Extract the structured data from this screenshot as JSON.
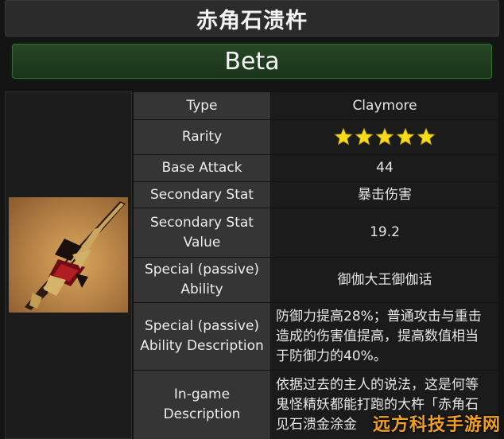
{
  "header": {
    "title": "赤角石溃杵"
  },
  "banner": {
    "label": "Beta"
  },
  "stats": {
    "type_label": "Type",
    "type_value": "Claymore",
    "rarity_label": "Rarity",
    "rarity_stars": 5,
    "base_attack_label": "Base Attack",
    "base_attack_value": "44",
    "secondary_stat_label": "Secondary Stat",
    "secondary_stat_value": "暴击伤害",
    "secondary_stat_value_label_1": "Secondary Stat",
    "secondary_stat_value_label_2": "Value",
    "secondary_stat_value_value": "19.2",
    "special_ability_label_1": "Special (passive)",
    "special_ability_label_2": "Ability",
    "special_ability_value": "御伽大王御伽话",
    "special_desc_label_1": "Special (passive)",
    "special_desc_label_2": "Ability Description",
    "special_desc_line_1": "防御力提高28%；普通攻击与重击",
    "special_desc_line_2": "造成的伤害值提高，提高数值相当",
    "special_desc_line_3": "于防御力的40%。",
    "ingame_desc_label_1": "In-game",
    "ingame_desc_label_2": "Description",
    "ingame_desc_line_1": "依据过去的主人的说法，这是何等",
    "ingame_desc_line_2": "鬼怪精妖都能打跑的大杵「赤角石",
    "ingame_desc_line_3": "见石溃金涂金"
  },
  "colors": {
    "star": "#f7dc1a",
    "type_value": "#d8b24a",
    "banner": "#274726"
  },
  "watermark": {
    "text": "远方科技手游网"
  }
}
